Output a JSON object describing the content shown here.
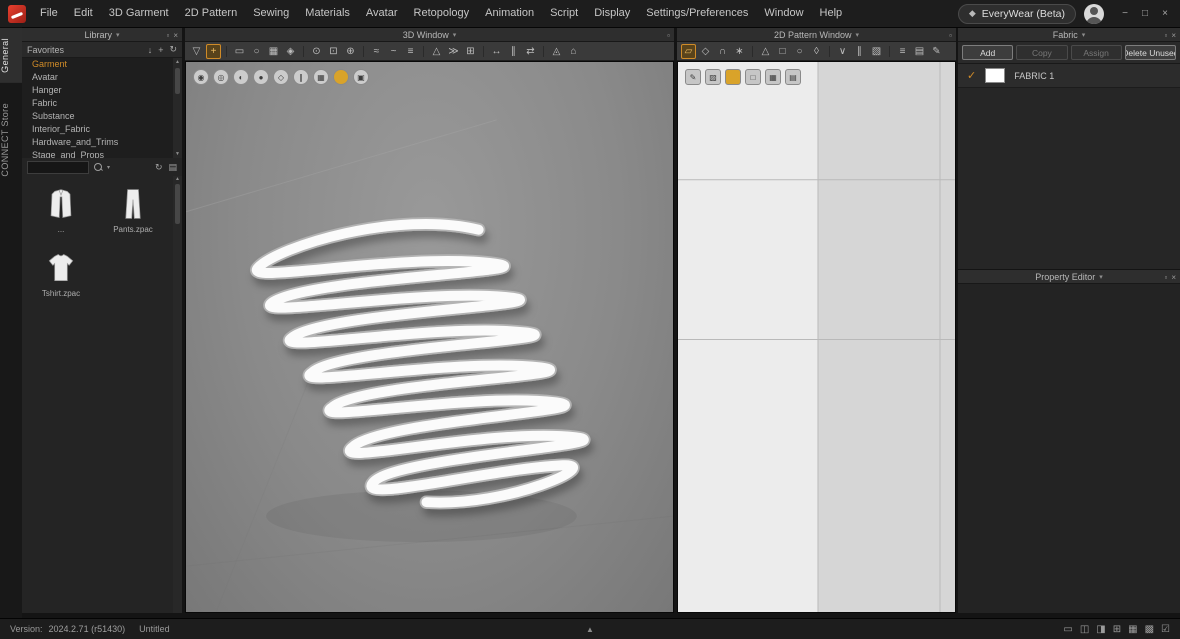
{
  "glyphs": {
    "caret": "▾",
    "undock": "▫",
    "close": "×",
    "scroll_up": "▲",
    "scroll_down": "▼",
    "min": "−",
    "max": "□",
    "win_close": "×",
    "expand_tri": "▲",
    "badge_icon": "◆",
    "search_caret": "▾"
  },
  "menu": {
    "items": [
      "File",
      "Edit",
      "3D Garment",
      "2D Pattern",
      "Sewing",
      "Materials",
      "Avatar",
      "Retopology",
      "Animation",
      "Script",
      "Display",
      "Settings/Preferences",
      "Window",
      "Help"
    ],
    "app_badge": "EveryWear (Beta)"
  },
  "side_tabs": {
    "general": "General",
    "connect": "CONNECT Store"
  },
  "library": {
    "title": "Library",
    "favorites_label": "Favorites",
    "favorite_actions": [
      {
        "name": "import-favorite-icon",
        "glyph": "↓"
      },
      {
        "name": "add-favorite-icon",
        "glyph": "+"
      },
      {
        "name": "refresh-favorites-icon",
        "glyph": "↻"
      }
    ],
    "items": [
      {
        "name": "library-item-garment",
        "label": "Garment",
        "selected": true
      },
      {
        "name": "library-item-avatar",
        "label": "Avatar"
      },
      {
        "name": "library-item-hanger",
        "label": "Hanger"
      },
      {
        "name": "library-item-fabric",
        "label": "Fabric"
      },
      {
        "name": "library-item-substance",
        "label": "Substance"
      },
      {
        "name": "library-item-interior-fabric",
        "label": "Interior_Fabric"
      },
      {
        "name": "library-item-hardware-and-trims",
        "label": "Hardware_and_Trims"
      },
      {
        "name": "library-item-stage-and-props",
        "label": "Stage_and_Props"
      }
    ],
    "search": {
      "value": "",
      "placeholder": ""
    },
    "search_actions": [
      {
        "name": "search-refresh-icon",
        "glyph": "↻"
      },
      {
        "name": "view-mode-icon",
        "glyph": "▤"
      }
    ],
    "files": [
      {
        "label": "..."
      },
      {
        "label": "Pants.zpac"
      },
      {
        "label": "Tshirt.zpac"
      }
    ]
  },
  "windows": {
    "w3d": {
      "title": "3D Window"
    },
    "w2d": {
      "title": "2D Pattern Window"
    }
  },
  "toolbar3d": {
    "icons": [
      {
        "name": "simulate-tool-icon",
        "glyph": "▽"
      },
      {
        "name": "select-move-tool-icon",
        "glyph": "+",
        "selected": true
      },
      {
        "sep": true
      },
      {
        "name": "select-box-tool-icon",
        "glyph": "▭"
      },
      {
        "name": "select-lasso-tool-icon",
        "glyph": "○"
      },
      {
        "name": "select-mesh-tool-icon",
        "glyph": "▦"
      },
      {
        "name": "assign-material-tool-icon",
        "glyph": "◈"
      },
      {
        "sep": true
      },
      {
        "name": "pin-tool-icon",
        "glyph": "⊙"
      },
      {
        "name": "pin-box-tool-icon",
        "glyph": "⊡"
      },
      {
        "name": "tack-on-avatar-tool-icon",
        "glyph": "⊕"
      },
      {
        "sep": true
      },
      {
        "name": "segment-sewing-tool-icon",
        "glyph": "≈"
      },
      {
        "name": "free-sewing-tool-icon",
        "glyph": "~"
      },
      {
        "name": "edit-sewing-tool-icon",
        "glyph": "≡"
      },
      {
        "sep": true
      },
      {
        "name": "fold-arrangement-tool-icon",
        "glyph": "△"
      },
      {
        "name": "wind-tool-icon",
        "glyph": "≫"
      },
      {
        "name": "arrange-grid-tool-icon",
        "glyph": "⊞"
      },
      {
        "sep": true
      },
      {
        "name": "measure-tool-icon",
        "glyph": "↔"
      },
      {
        "name": "tape-tool-icon",
        "glyph": "∥"
      },
      {
        "name": "flatten-tool-icon",
        "glyph": "⇄"
      },
      {
        "sep": true
      },
      {
        "name": "strain-map-tool-icon",
        "glyph": "◬"
      },
      {
        "name": "fit-view-tool-icon",
        "glyph": "⌂"
      }
    ]
  },
  "toolbar2d": {
    "icons": [
      {
        "name": "transform-pattern-tool-icon",
        "glyph": "▱",
        "selected": true
      },
      {
        "name": "edit-pattern-tool-icon",
        "glyph": "◇"
      },
      {
        "name": "edit-curvature-tool-icon",
        "glyph": "∩"
      },
      {
        "name": "add-point-tool-icon",
        "glyph": "∗"
      },
      {
        "sep": true
      },
      {
        "name": "polygon-tool-icon",
        "glyph": "△"
      },
      {
        "name": "rectangle-tool-icon",
        "glyph": "□"
      },
      {
        "name": "circle-tool-icon",
        "glyph": "○"
      },
      {
        "name": "dart-tool-icon",
        "glyph": "◊"
      },
      {
        "sep": true
      },
      {
        "name": "notch-tool-icon",
        "glyph": "∨"
      },
      {
        "name": "seam-allowance-tool-icon",
        "glyph": "∥"
      },
      {
        "name": "trace-tool-icon",
        "glyph": "▧"
      },
      {
        "sep": true
      },
      {
        "name": "grading-tool-icon",
        "glyph": "≡"
      },
      {
        "name": "print-layout-tool-icon",
        "glyph": "▤"
      },
      {
        "name": "pen-tool-icon",
        "glyph": "✎"
      }
    ]
  },
  "view3d_icons": [
    {
      "name": "show-avatar-icon",
      "glyph": "◉"
    },
    {
      "name": "show-garment-icon",
      "glyph": "◎"
    },
    {
      "name": "show-arrangement-points-icon",
      "glyph": "◐"
    },
    {
      "name": "show-avatar-skin-icon",
      "glyph": "●"
    },
    {
      "name": "show-bounding-volumes-icon",
      "glyph": "◇"
    },
    {
      "name": "show-avatar-tape-icon",
      "glyph": "∥"
    },
    {
      "name": "show-grid-icon",
      "glyph": "▦"
    },
    {
      "name": "material-sphere-icon",
      "glyph": "",
      "bg": "#d9a32a"
    },
    {
      "name": "render-view-icon",
      "glyph": "▣"
    }
  ],
  "view2d_icons": [
    {
      "name": "brush-tool-icon",
      "glyph": "✎"
    },
    {
      "name": "show-pattern-mesh-icon",
      "glyph": "▨"
    },
    {
      "name": "material-sphere-2d-icon",
      "glyph": "",
      "bg": "#d9a32a"
    },
    {
      "name": "show-base-fabric-icon",
      "glyph": "□"
    },
    {
      "name": "show-grid-2d-icon",
      "glyph": "▦"
    },
    {
      "name": "print-area-icon",
      "glyph": "▤"
    }
  ],
  "fabric_panel": {
    "title": "Fabric",
    "buttons": [
      {
        "name": "add-fabric-button",
        "label": "Add"
      },
      {
        "name": "copy-fabric-button",
        "label": "Copy",
        "disabled": true
      },
      {
        "name": "assign-fabric-button",
        "label": "Assign",
        "disabled": true
      },
      {
        "name": "delete-unused-fabric-button",
        "label": "Delete Unused"
      }
    ],
    "items": [
      {
        "name": "FABRIC 1"
      }
    ]
  },
  "property_editor": {
    "title": "Property Editor"
  },
  "statusbar": {
    "version_label": "Version:",
    "version": "2024.2.71 (r51430)",
    "filename": "Untitled",
    "icons": [
      {
        "name": "layout-preset-1-icon",
        "glyph": "▭"
      },
      {
        "name": "layout-preset-2-icon",
        "glyph": "◫"
      },
      {
        "name": "layout-preset-3-icon",
        "glyph": "◨"
      },
      {
        "name": "layout-preset-4-icon",
        "glyph": "⊞"
      },
      {
        "name": "layout-preset-5-icon",
        "glyph": "▦"
      },
      {
        "name": "layout-preset-6-icon",
        "glyph": "▩"
      },
      {
        "name": "layout-confirm-icon",
        "glyph": "☑"
      }
    ]
  },
  "colors": {
    "accent": "#d08b28",
    "viewport_bg": "#8d8d8d",
    "pattern_bg": "#d6d6d6"
  }
}
